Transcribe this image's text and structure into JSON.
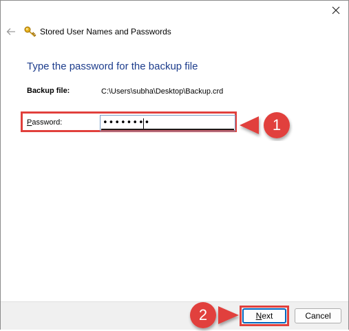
{
  "window": {
    "title": "Stored User Names and Passwords",
    "close_glyph": "✕",
    "back_glyph": "←"
  },
  "heading": "Type the password for the backup file",
  "backup_file": {
    "label": "Backup file:",
    "value": "C:\\Users\\subha\\Desktop\\Backup.crd"
  },
  "password": {
    "label": "Password:",
    "value": "••••••••"
  },
  "buttons": {
    "next": "Next",
    "cancel": "Cancel"
  },
  "callouts": {
    "step1": "1",
    "step2": "2"
  },
  "colors": {
    "annotation_red": "#e1403c",
    "heading_blue": "#1c3c8c",
    "focus_blue": "#0067c0"
  },
  "icons": [
    "close-icon",
    "back-arrow-icon",
    "key-icon"
  ]
}
